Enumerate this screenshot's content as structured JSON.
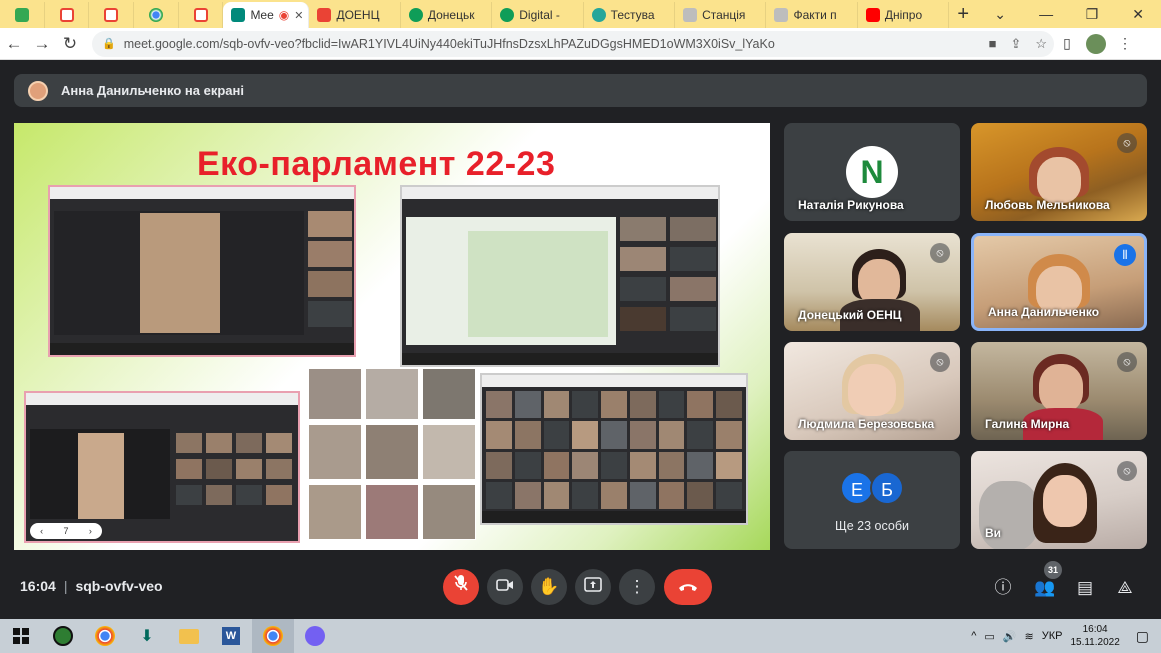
{
  "browser": {
    "tabs": [
      {
        "label": "",
        "icon": "classroom-icon",
        "color": "#34a853"
      },
      {
        "label": "",
        "icon": "gmail-icon",
        "color": "#ea4335"
      },
      {
        "label": "",
        "icon": "gmail-icon",
        "color": "#ea4335"
      },
      {
        "label": "",
        "icon": "chrome-icon",
        "color": "#4285f4"
      },
      {
        "label": "",
        "icon": "gmail-icon",
        "color": "#ea4335"
      },
      {
        "label": "Mee",
        "icon": "meet-icon",
        "color": "#00897b",
        "active": true
      },
      {
        "label": "ДОЕНЦ",
        "icon": "maps-icon",
        "color": "#ea4335"
      },
      {
        "label": "Донецьк",
        "icon": "site-icon",
        "color": "#0f9d58"
      },
      {
        "label": "Digital -",
        "icon": "site-icon",
        "color": "#0f9d58"
      },
      {
        "label": "Тестува",
        "icon": "gear-icon",
        "color": "#26a69a"
      },
      {
        "label": "Станція",
        "icon": "page-icon",
        "color": "#9e9e9e"
      },
      {
        "label": "Факти п",
        "icon": "page-icon",
        "color": "#9e9e9e"
      },
      {
        "label": "Дніпро",
        "icon": "youtube-icon",
        "color": "#ff0000"
      }
    ],
    "url": "meet.google.com/sqb-ovfv-veo?fbclid=IwAR1YIVL4UiNy440ekiTuJHfnsDzsxLhPAZuDGgsHMED1oWM3X0iSv_lYaKo"
  },
  "meet": {
    "presenting_banner": "Анна Данильченко на екрані",
    "slide_title": "Еко-парламент 22-23",
    "slide_page": "7",
    "participants": [
      {
        "name": "Наталія Рикунова",
        "avatar_letter": "N",
        "avatar_color": "#fff",
        "letter_color": "#1e8a3c"
      },
      {
        "name": "Любовь Мельникова",
        "muted": true
      },
      {
        "name": "Донецький ОЕНЦ",
        "muted": true
      },
      {
        "name": "Анна Данильченко",
        "speaking": true
      },
      {
        "name": "Людмила Березовська",
        "muted": true
      },
      {
        "name": "Галина Мирна",
        "muted": true
      },
      {
        "name": "Ще 23 особи",
        "letters": [
          "Е",
          "Б"
        ],
        "letter_colors": [
          "#1a73e8",
          "#1967d2"
        ]
      },
      {
        "name": "Ви",
        "muted": true
      }
    ],
    "time": "16:04",
    "separator": "|",
    "meeting_code": "sqb-ovfv-veo",
    "people_count": "31"
  },
  "taskbar": {
    "lang": "УКР",
    "time": "16:04",
    "date": "15.11.2022"
  },
  "colors": {
    "accent_red": "#ea4335",
    "speaking_border": "#8ab4f8",
    "bg": "#202124"
  }
}
